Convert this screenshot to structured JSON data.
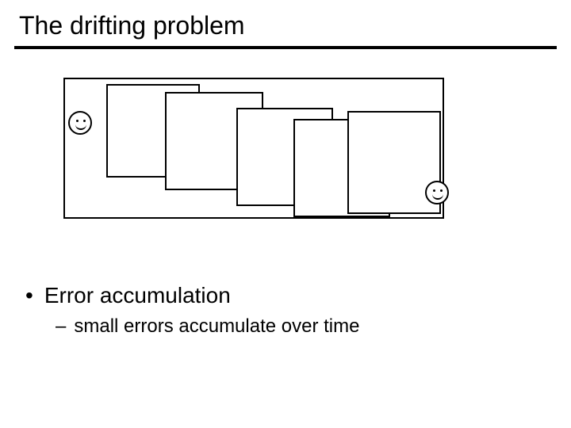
{
  "slide": {
    "title": "The drifting problem",
    "bullet1": "Error accumulation",
    "sub1": "small errors accumulate over time"
  }
}
